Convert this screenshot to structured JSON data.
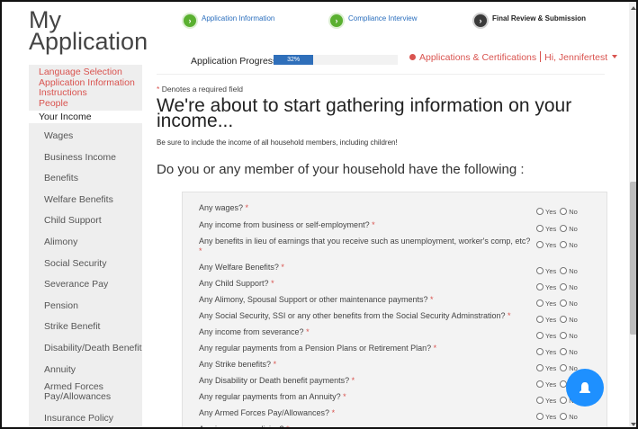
{
  "app": {
    "title_line1": "My",
    "title_line2": "Application"
  },
  "sidebar": {
    "links": [
      "Language Selection",
      "Application Information",
      "Instructions",
      "People"
    ],
    "current": "Your Income",
    "income_items": [
      "Wages",
      "Business Income",
      "Benefits",
      "Welfare Benefits",
      "Child Support",
      "Alimony",
      "Social Security",
      "Severance Pay",
      "Pension",
      "Strike Benefit",
      "Disability/Death Benefit",
      "Annuity",
      "Armed Forces Pay/Allowances",
      "Insurance Policy"
    ]
  },
  "steps": [
    {
      "label": "Application Information",
      "icon": "arrow-right-icon",
      "state": "complete"
    },
    {
      "label": "Compliance Interview",
      "icon": "arrow-right-icon",
      "state": "complete"
    },
    {
      "label": "Final Review & Submission",
      "icon": "arrow-right-icon",
      "state": "pending"
    }
  ],
  "progress": {
    "label": "Application Progress",
    "percent_text": "32%",
    "fraction": 0.32
  },
  "header": {
    "apps_link": "Applications & Certifications",
    "user_greeting": "Hi, Jennifertest"
  },
  "content": {
    "required_note": "Denotes a required field",
    "required_star": "*",
    "heading": "We're about to start gathering information on your income...",
    "subnote": "Be sure to include the income of all household members, including children!",
    "question": "Do you or any member of your household have the following :"
  },
  "questions": [
    {
      "text": "Any wages?",
      "required": "*"
    },
    {
      "text": "Any income from business or self-employment?",
      "required": "*"
    },
    {
      "text": "Any benefits in lieu of earnings that you receive such as unemployment, worker's comp, etc?",
      "required": "*"
    },
    {
      "text": "Any Welfare Benefits?",
      "required": "*"
    },
    {
      "text": "Any Child Support?",
      "required": "*"
    },
    {
      "text": "Any Alimony, Spousal Support or other maintenance payments?",
      "required": "*"
    },
    {
      "text": "Any Social Security, SSI or any other benefits from the Social Security Adminstration?",
      "required": "*"
    },
    {
      "text": "Any income from severance?",
      "required": "*"
    },
    {
      "text": "Any regular payments from a Pension Plans or Retirement Plan?",
      "required": "*"
    },
    {
      "text": "Any Strike benefits?",
      "required": "*"
    },
    {
      "text": "Any Disability or Death benefit payments?",
      "required": "*"
    },
    {
      "text": "Any regular payments from an Annuity?",
      "required": "*"
    },
    {
      "text": "Any Armed Forces Pay/Allowances?",
      "required": "*"
    },
    {
      "text": "Any insurance policies?",
      "required": "*"
    }
  ],
  "radio_labels": {
    "yes": "Yes",
    "no": "No"
  },
  "colors": {
    "accent_red": "#d9534f",
    "step_green": "#5ab030",
    "progress_blue": "#2f6fba",
    "fab_blue": "#1e90ff"
  },
  "fab": {
    "icon": "bell-icon"
  }
}
